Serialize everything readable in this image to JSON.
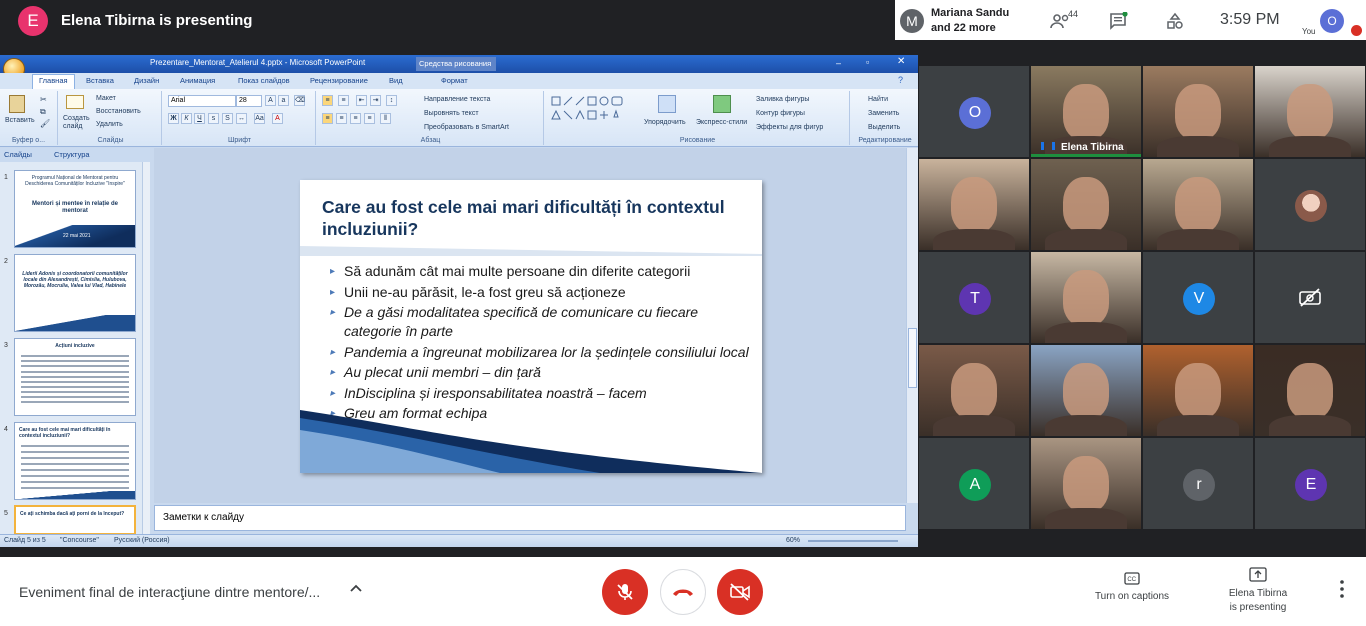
{
  "topbar": {
    "presenter_initial": "E",
    "presenter_title": "Elena Tibirna is presenting",
    "presenting_group": {
      "initial": "M",
      "line1": "Mariana Sandu",
      "line2": "and 22 more"
    },
    "participants_count": "44",
    "time": "3:59 PM",
    "you_initial": "O",
    "you_label": "You"
  },
  "ppt": {
    "window_title": "Prezentare_Mentorat_Atelierul 4.pptx - Microsoft PowerPoint",
    "contextual_tab": "Средства рисования",
    "tabs": [
      "Главная",
      "Вставка",
      "Дизайн",
      "Анимация",
      "Показ слайдов",
      "Рецензирование",
      "Вид",
      "Формат"
    ],
    "ribbon": {
      "clipboard": {
        "paste": "Вставить",
        "group": "Буфер о...",
        "cut": "",
        "copy": "",
        "format": ""
      },
      "slides": {
        "create": "Создать слайд",
        "layout": "Макет",
        "reset": "Восстановить",
        "delete": "Удалить",
        "group": "Слайды"
      },
      "font": {
        "name": "Arial",
        "size": "28",
        "group": "Шрифт",
        "bold": "Ж",
        "italic": "К",
        "underline": "Ч"
      },
      "paragraph": {
        "dir": "Направление текста",
        "align": "Выровнять текст",
        "smartart": "Преобразовать в SmartArt",
        "group": "Абзац"
      },
      "drawing": {
        "arrange": "Упорядочить",
        "styles": "Экспресс-стили",
        "fill": "Заливка фигуры",
        "outline": "Контур фигуры",
        "effects": "Эффекты для фигур",
        "group": "Рисование"
      },
      "editing": {
        "find": "Найти",
        "replace": "Заменить",
        "select": "Выделить",
        "group": "Редактирование"
      }
    },
    "panel_tabs": {
      "slides": "Слайды",
      "outline": "Структура"
    },
    "thumbs": [
      {
        "num": "1",
        "title": "Programul Național de Mentorat pentru Deschiderea Comunităților Incluzive \"Inspire\"",
        "subtitle": "Mentori și mentee în relație de mentorat",
        "date": "22 mai 2021"
      },
      {
        "num": "2",
        "title": "Liderii Adonis și coordonatorii comunităților locale din Alexandrești, Cimislia, Hulubova, Morozău, Mocrulia, Valea lui Vlad, Habinele"
      },
      {
        "num": "3",
        "title": "Acțiuni incluzive"
      },
      {
        "num": "4",
        "title": "Care au fost cele mai mari dificultăți în contextul incluziunii?"
      },
      {
        "num": "5",
        "title": "Ce ați schimba dacă ați porni de la început?"
      }
    ],
    "slide": {
      "title": "Care au fost cele mai mari dificultăți în contextul incluziunii?",
      "bullets": [
        {
          "text": "Să adunăm cât mai multe persoane din diferite categorii",
          "italic": false
        },
        {
          "text": "Unii ne-au părăsit, le-a fost greu să acționeze",
          "italic": false
        },
        {
          "text": "De a găsi modalitatea specifică de comunicare cu fiecare categorie în parte",
          "italic": true
        },
        {
          "text": "Pandemia a îngreunat mobilizarea lor la ședințele consiliului local",
          "italic": true
        },
        {
          "text": "Au plecat unii membri – din țară",
          "italic": true
        },
        {
          "text": "InDisciplina și iresponsabilitatea noastră – facem",
          "italic": true
        },
        {
          "text": "Greu am format echipa",
          "italic": true
        }
      ]
    },
    "notes_placeholder": "Заметки к слайду",
    "status": {
      "slide": "Слайд 5 из 5",
      "theme": "\"Concourse\"",
      "lang": "Русский (Россия)",
      "zoom": "60%"
    }
  },
  "participants": [
    {
      "initial": "O",
      "color": "#5b6fd6",
      "video": false
    },
    {
      "name": "Elena Tibirna",
      "video": true,
      "bg": "#8a7a60"
    },
    {
      "video": true,
      "bg": "#9b7b60"
    },
    {
      "video": true,
      "bg": "#d9d3cb"
    },
    {
      "video": true,
      "bg": "#c9b39c"
    },
    {
      "video": true,
      "bg": "#6f6150"
    },
    {
      "video": true,
      "bg": "#b8a890"
    },
    {
      "avatar_photo": true,
      "video": false
    },
    {
      "initial": "T",
      "color": "#5e35b1",
      "video": false
    },
    {
      "video": true,
      "bg": "#c7b8a4"
    },
    {
      "initial": "V",
      "color": "#1e88e5",
      "video": false
    },
    {
      "cam_off": true,
      "video": false
    },
    {
      "video": true,
      "bg": "#7a5a48"
    },
    {
      "video": true,
      "bg": "#8aa4c4"
    },
    {
      "video": true,
      "bg": "#b0612e"
    },
    {
      "video": true,
      "bg": "#3a2c24"
    },
    {
      "initial": "A",
      "color": "#0f9d58",
      "video": false
    },
    {
      "video": true,
      "bg": "#a99582"
    },
    {
      "initial": "r",
      "color": "#5f6368",
      "video": false
    },
    {
      "initial": "E",
      "color": "#5e35b1",
      "video": false
    }
  ],
  "bottombar": {
    "meeting_title": "Eveniment final de interacţiune dintre mentore/...",
    "captions_label": "Turn on captions",
    "presenting_line1": "Elena Tibirna",
    "presenting_line2": "is presenting"
  },
  "colors": {
    "mic_off": "#d93025",
    "end_call": "#ffffff",
    "accent": "#1a73e8"
  }
}
